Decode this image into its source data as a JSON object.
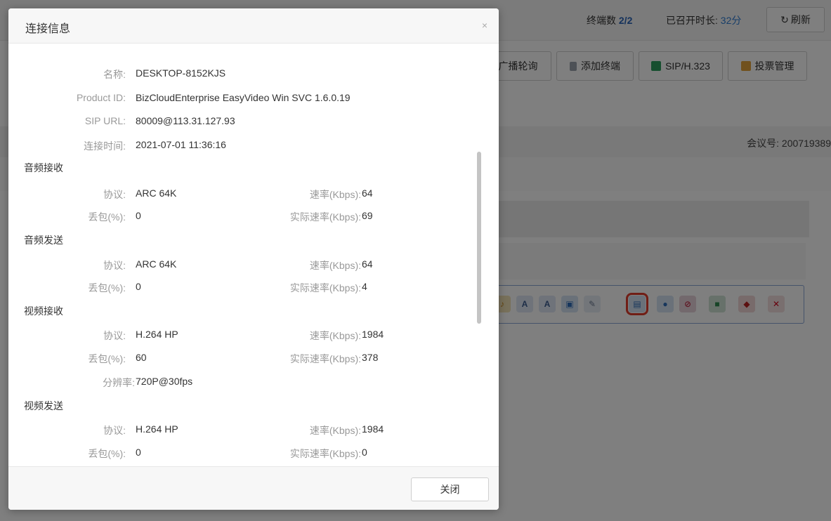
{
  "topbar": {
    "terminals_label": "终端数",
    "terminals_value": "2/2",
    "duration_label": "已召开时长:",
    "duration_value": "32分",
    "refresh_label": "刷新"
  },
  "toolbar": {
    "broadcast_poll": "广播轮询",
    "add_terminal": "添加终端",
    "sip_h323": "SIP/H.323",
    "vote_manage": "投票管理"
  },
  "meeting": {
    "meeting_number": "会议号: 200719389"
  },
  "modal": {
    "title": "连接信息",
    "close_x": "×",
    "close_button": "关闭",
    "info": [
      {
        "label": "名称:",
        "value": "DESKTOP-8152KJS"
      },
      {
        "label": "Product ID:",
        "value": "BizCloudEnterprise EasyVideo Win SVC 1.6.0.19"
      },
      {
        "label": "SIP URL:",
        "value": "80009@113.31.127.93"
      },
      {
        "label": "连接时间:",
        "value": "2021-07-01 11:36:16"
      }
    ],
    "sections": [
      {
        "title": "音频接收",
        "protocol_label": "协议:",
        "protocol": "ARC 64K",
        "rate_label": "速率(Kbps):",
        "rate": "64",
        "loss_label": "丢包(%):",
        "loss": "0",
        "actual_label": "实际速率(Kbps):",
        "actual": "69"
      },
      {
        "title": "音频发送",
        "protocol_label": "协议:",
        "protocol": "ARC 64K",
        "rate_label": "速率(Kbps):",
        "rate": "64",
        "loss_label": "丢包(%):",
        "loss": "0",
        "actual_label": "实际速率(Kbps):",
        "actual": "4"
      },
      {
        "title": "视频接收",
        "protocol_label": "协议:",
        "protocol": "H.264 HP",
        "rate_label": "速率(Kbps):",
        "rate": "1984",
        "loss_label": "丢包(%):",
        "loss": "60",
        "actual_label": "实际速率(Kbps):",
        "actual": "378",
        "resolution_label": "分辨率:",
        "resolution": "720P@30fps"
      },
      {
        "title": "视频发送",
        "protocol_label": "协议:",
        "protocol": "H.264 HP",
        "rate_label": "速率(Kbps):",
        "rate": "1984",
        "loss_label": "丢包(%):",
        "loss": "0",
        "actual_label": "实际速率(Kbps):",
        "actual": "0"
      }
    ]
  },
  "controls": {
    "icons": [
      "speaker-icon",
      "broadcast-icon",
      "broadcast-cancel-icon",
      "screen-share-icon",
      "edit-icon",
      "connection-info-icon",
      "microphone-icon",
      "mute-icon",
      "camera-icon",
      "hangup-icon",
      "remove-icon"
    ],
    "colors": {
      "accent": "#2f7cd3",
      "highlight": "#e03c2c",
      "remove": "#d0021b"
    }
  }
}
